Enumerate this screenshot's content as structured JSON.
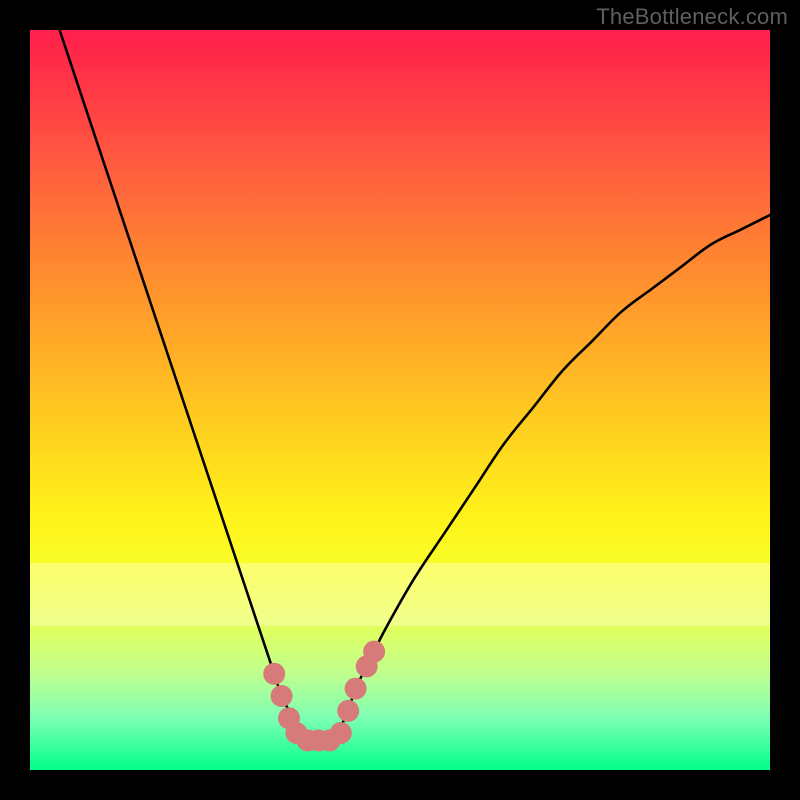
{
  "attribution": "TheBottleneck.com",
  "colors": {
    "frame": "#000000",
    "curve": "#000000",
    "marker": "#d77a7a",
    "gradient_top": "#ff1f4b",
    "gradient_bottom": "#00ff85"
  },
  "chart_data": {
    "type": "line",
    "title": "",
    "xlabel": "",
    "ylabel": "",
    "xlim": [
      0,
      100
    ],
    "ylim": [
      0,
      100
    ],
    "grid": false,
    "series": [
      {
        "name": "bottleneck-curve",
        "x": [
          4,
          6,
          8,
          10,
          12,
          14,
          16,
          18,
          20,
          22,
          24,
          26,
          28,
          30,
          32,
          33,
          34,
          35,
          36,
          37,
          38,
          39,
          40,
          41,
          42,
          43,
          44,
          46,
          48,
          52,
          56,
          60,
          64,
          68,
          72,
          76,
          80,
          84,
          88,
          92,
          96,
          100
        ],
        "y": [
          100,
          94,
          88,
          82,
          76,
          70,
          64,
          58,
          52,
          46,
          40,
          34,
          28,
          22,
          16,
          13,
          10,
          8,
          6,
          5,
          4,
          4,
          4,
          5,
          6,
          8,
          11,
          15,
          19,
          26,
          32,
          38,
          44,
          49,
          54,
          58,
          62,
          65,
          68,
          71,
          73,
          75
        ]
      }
    ],
    "markers": [
      {
        "x": 33.0,
        "y": 13
      },
      {
        "x": 34.0,
        "y": 10
      },
      {
        "x": 35.0,
        "y": 7
      },
      {
        "x": 36.0,
        "y": 5
      },
      {
        "x": 37.5,
        "y": 4
      },
      {
        "x": 39.0,
        "y": 4
      },
      {
        "x": 40.5,
        "y": 4
      },
      {
        "x": 42.0,
        "y": 5
      },
      {
        "x": 43.0,
        "y": 8
      },
      {
        "x": 44.0,
        "y": 11
      },
      {
        "x": 45.5,
        "y": 14
      },
      {
        "x": 46.5,
        "y": 16
      }
    ],
    "background_bands": [
      {
        "name": "pale-yellow-band",
        "y_from": 72,
        "y_to": 80
      }
    ]
  }
}
